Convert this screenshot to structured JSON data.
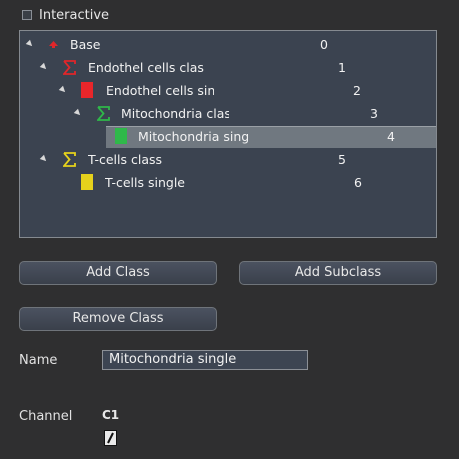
{
  "interactive": {
    "label": "Interactive",
    "checked": false
  },
  "tree": {
    "rows": [
      {
        "label": "Base",
        "value": "0",
        "icon": "red-arrow-up-icon",
        "color": "#e0262a"
      },
      {
        "label": "Endothel cells clas",
        "value": "1",
        "icon": "sigma-icon",
        "color": "#e0262a"
      },
      {
        "label": "Endothel cells sinç",
        "value": "2",
        "icon": "square-icon",
        "color": "#e8262a"
      },
      {
        "label": "Mitochondria clas",
        "value": "3",
        "icon": "sigma-icon",
        "color": "#2fb84a"
      },
      {
        "label": "Mitochondria sing",
        "value": "4",
        "icon": "square-icon",
        "color": "#2fb84a"
      },
      {
        "label": "T-cells class",
        "value": "5",
        "icon": "sigma-icon",
        "color": "#e6d21c"
      },
      {
        "label": "T-cells single",
        "value": "6",
        "icon": "square-icon",
        "color": "#e6d21c"
      }
    ],
    "selected_index": 4
  },
  "buttons": {
    "add_class": "Add Class",
    "add_subclass": "Add Subclass",
    "remove_class": "Remove Class"
  },
  "name": {
    "label": "Name",
    "value": "Mitochondria single"
  },
  "channel": {
    "label": "Channel",
    "value": "C1"
  }
}
